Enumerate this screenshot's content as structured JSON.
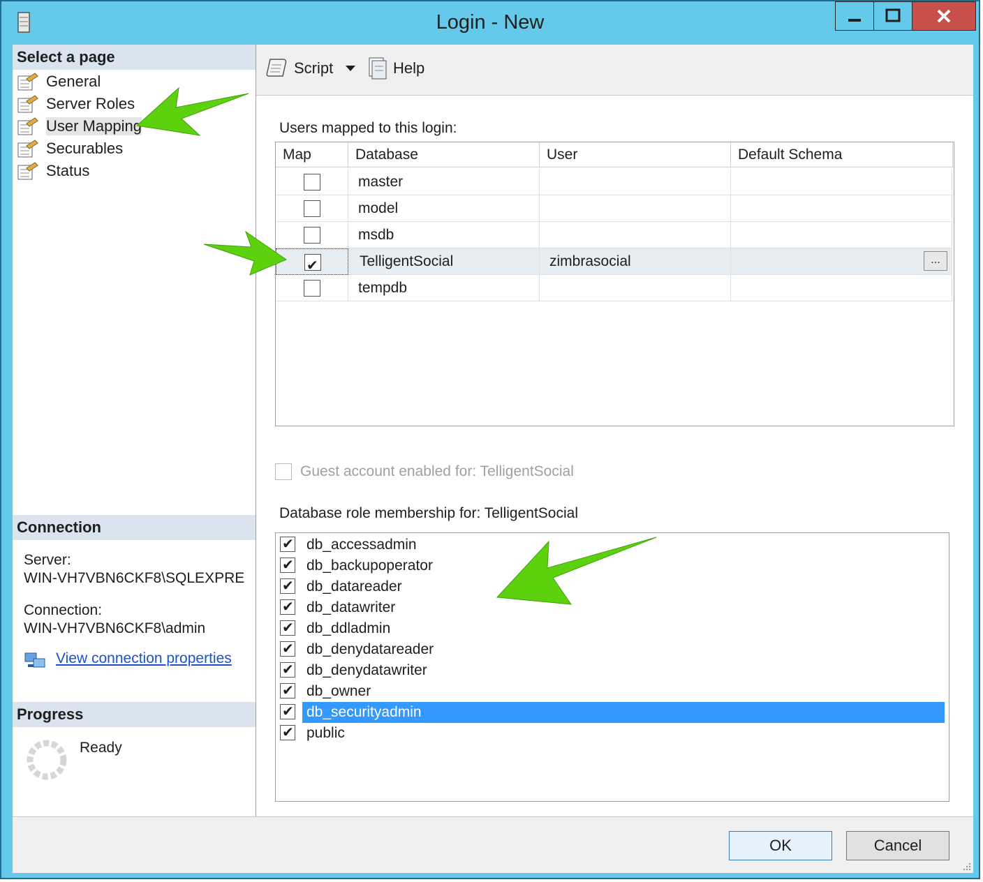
{
  "window": {
    "title": "Login - New"
  },
  "left": {
    "select_page_header": "Select a page",
    "pages": [
      {
        "label": "General"
      },
      {
        "label": "Server Roles"
      },
      {
        "label": "User Mapping"
      },
      {
        "label": "Securables"
      },
      {
        "label": "Status"
      }
    ],
    "connection_header": "Connection",
    "server_label": "Server:",
    "server_value": "WIN-VH7VBN6CKF8\\SQLEXPRE",
    "connection_label": "Connection:",
    "connection_value": "WIN-VH7VBN6CKF8\\admin",
    "view_connection_link": "View connection properties",
    "progress_header": "Progress",
    "progress_status": "Ready"
  },
  "toolbar": {
    "script_label": "Script",
    "help_label": "Help"
  },
  "users_mapped": {
    "label": "Users mapped to this login:",
    "columns": [
      "Map",
      "Database",
      "User",
      "Default Schema"
    ],
    "rows": [
      {
        "checked": false,
        "database": "master",
        "user": "",
        "schema": ""
      },
      {
        "checked": false,
        "database": "model",
        "user": "",
        "schema": ""
      },
      {
        "checked": false,
        "database": "msdb",
        "user": "",
        "schema": ""
      },
      {
        "checked": true,
        "database": "TelligentSocial",
        "user": "zimbrasocial",
        "schema": ""
      },
      {
        "checked": false,
        "database": "tempdb",
        "user": "",
        "schema": ""
      }
    ],
    "browse_button": "..."
  },
  "guest_account": {
    "label": "Guest account enabled for: TelligentSocial",
    "checked": false
  },
  "role_membership": {
    "label": "Database role membership for: TelligentSocial",
    "roles": [
      {
        "name": "db_accessadmin",
        "checked": true
      },
      {
        "name": "db_backupoperator",
        "checked": true
      },
      {
        "name": "db_datareader",
        "checked": true
      },
      {
        "name": "db_datawriter",
        "checked": true
      },
      {
        "name": "db_ddladmin",
        "checked": true
      },
      {
        "name": "db_denydatareader",
        "checked": true
      },
      {
        "name": "db_denydatawriter",
        "checked": true
      },
      {
        "name": "db_owner",
        "checked": true
      },
      {
        "name": "db_securityadmin",
        "checked": true
      },
      {
        "name": "public",
        "checked": true
      }
    ]
  },
  "buttons": {
    "ok": "OK",
    "cancel": "Cancel"
  },
  "colors": {
    "titlebar": "#65c9ea",
    "close": "#c7504a",
    "selection": "#3399ff",
    "arrow": "#5ed10f"
  }
}
